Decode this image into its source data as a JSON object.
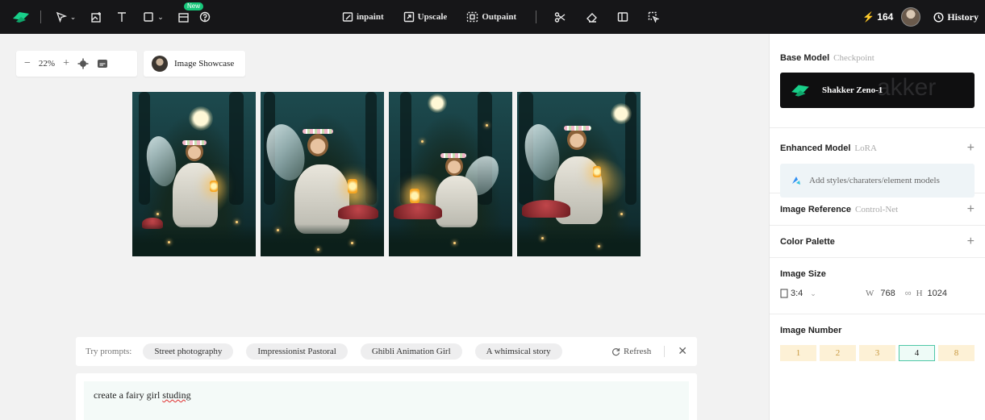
{
  "toolbar": {
    "new_badge": "New",
    "center_tools": [
      {
        "label": "inpaint",
        "icon": "inpaint-icon"
      },
      {
        "label": "Upscale",
        "icon": "upscale-icon"
      },
      {
        "label": "Outpaint",
        "icon": "outpaint-icon"
      }
    ],
    "credits": "164",
    "history_label": "History"
  },
  "canvas": {
    "zoom": "22%",
    "showcase_label": "Image Showcase",
    "image_count": 4
  },
  "prompts": {
    "try_label": "Try prompts:",
    "chips": [
      "Street photography",
      "Impressionist Pastoral",
      "Ghibli Animation Girl",
      "A whimsical story"
    ],
    "refresh_label": "Refresh",
    "input_text_before": "create a fairy girl ",
    "input_text_misspelled": "studing"
  },
  "panel": {
    "base_model": {
      "title": "Base Model",
      "sub": "Checkpoint",
      "model_name": "Shakker Zeno-1",
      "watermark": "akker"
    },
    "enhanced_model": {
      "title": "Enhanced Model",
      "sub": "LoRA",
      "placeholder": "Add styles/charaters/element models"
    },
    "image_reference": {
      "title": "Image Reference",
      "sub": "Control-Net"
    },
    "color_palette": {
      "title": "Color Palette"
    },
    "image_size": {
      "title": "Image Size",
      "ratio": "3:4",
      "w_label": "W",
      "w_value": "768",
      "h_label": "H",
      "h_value": "1024"
    },
    "image_number": {
      "title": "Image Number",
      "options": [
        "1",
        "2",
        "3",
        "4",
        "8"
      ],
      "selected": "4"
    }
  },
  "colors": {
    "accent": "#17c77a",
    "topbar": "#161618",
    "selected_border": "#4fc7a6",
    "number_bg": "#fdf1d6"
  }
}
